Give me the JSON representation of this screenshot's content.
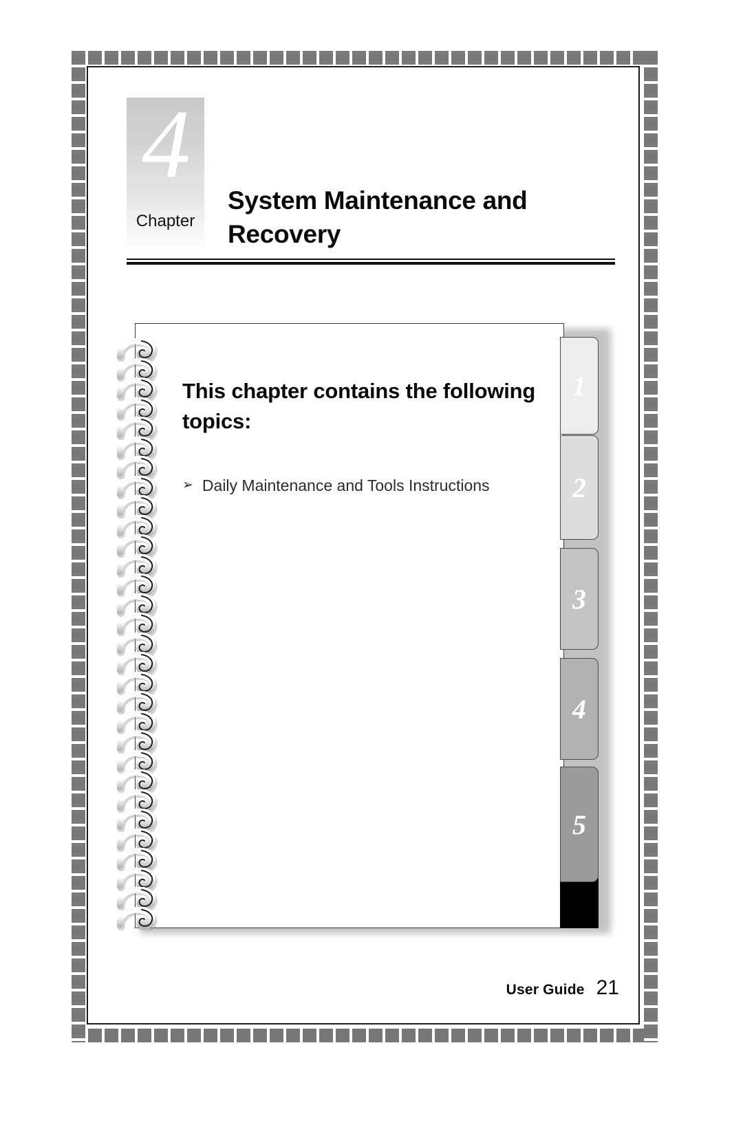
{
  "document": {
    "chapter_label": "Chapter",
    "chapter_number": "4",
    "chapter_title": "System Maintenance and Recovery"
  },
  "notebook": {
    "heading": "This chapter contains the following topics:",
    "bullet_glyph": "➢",
    "topics": [
      {
        "label": "Daily Maintenance and Tools Instructions"
      }
    ],
    "tabs": [
      {
        "number": "1",
        "color": "#ebeeed"
      },
      {
        "number": "2",
        "color": "#dcdddd"
      },
      {
        "number": "3",
        "color": "#c3c4c4"
      },
      {
        "number": "4",
        "color": "#b1b2b2"
      },
      {
        "number": "5",
        "color": "#9a9b9b"
      }
    ],
    "ring_count": 30
  },
  "footer": {
    "label": "User Guide",
    "page_number": "21"
  },
  "colors": {
    "frame_dash": "#787878",
    "rule": "#101010",
    "tab_border": "#4a4a4a",
    "tab_shadow": "#000000"
  }
}
